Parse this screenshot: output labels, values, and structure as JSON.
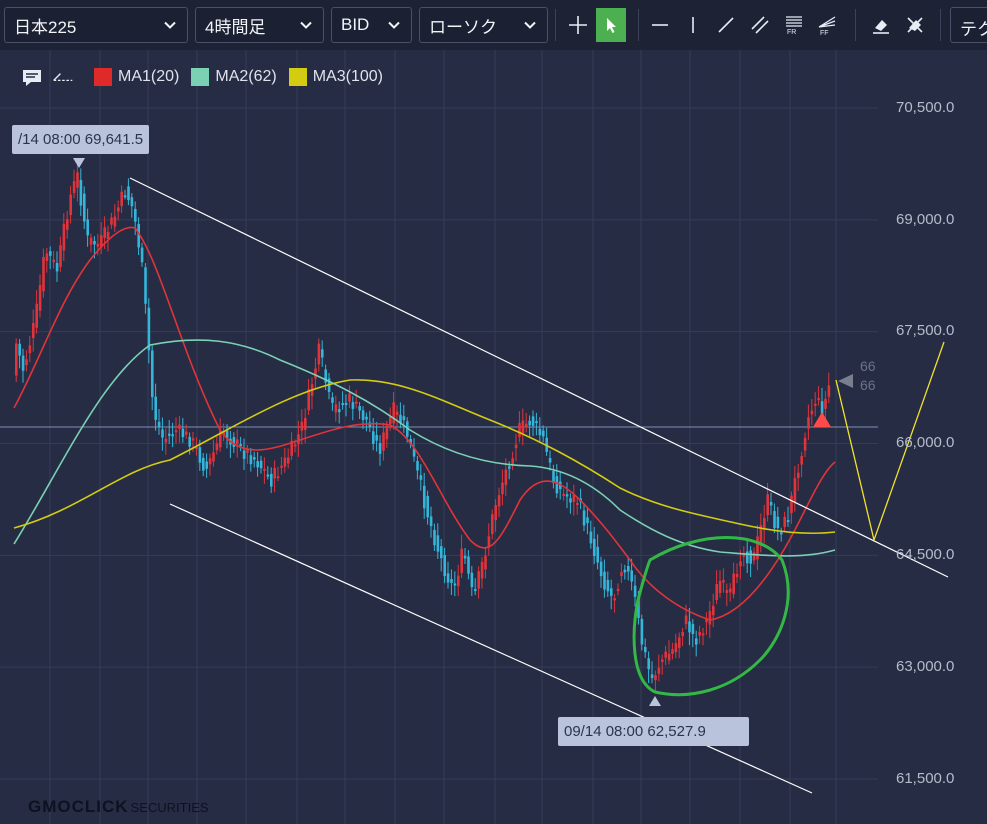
{
  "toolbar": {
    "symbol": "日本225",
    "timeframe": "4時間足",
    "price_type": "BID",
    "chart_style": "ローソク",
    "tech_label": "テク",
    "tools": [
      "crosshair-icon",
      "pointer-icon",
      "horizontal-line-icon",
      "vertical-line-icon",
      "trend-line-icon",
      "parallel-channel-icon",
      "fibonacci-retracement-icon",
      "fibonacci-fan-icon",
      "eraser-icon",
      "clear-drawings-icon"
    ]
  },
  "legend": {
    "ma1": {
      "label": "MA1(20)",
      "color": "#e02a2a"
    },
    "ma2": {
      "label": "MA2(62)",
      "color": "#7ad1b4"
    },
    "ma3": {
      "label": "MA3(100)",
      "color": "#d4cc10"
    }
  },
  "price_axis": [
    "70,500.0",
    "69,000.0",
    "67,500.0",
    "66,000.0",
    "64,500.0",
    "63,000.0",
    "61,500.0"
  ],
  "high_callout": "/14 08:00 69,641.5",
  "low_callout": "09/14 08:00 62,527.9",
  "current_price_cut": [
    "66",
    "66"
  ],
  "colors": {
    "background": "#262c44",
    "candle_up": "#e0343a",
    "candle_down": "#33b6d9",
    "channel": "#ffffff",
    "projection": "#f2e22a",
    "annotation_circle": "#33b846",
    "current_marker": "#ff4a4a"
  },
  "logo": {
    "brand": "GMOCLICK",
    "suffix": "SECURITIES"
  }
}
